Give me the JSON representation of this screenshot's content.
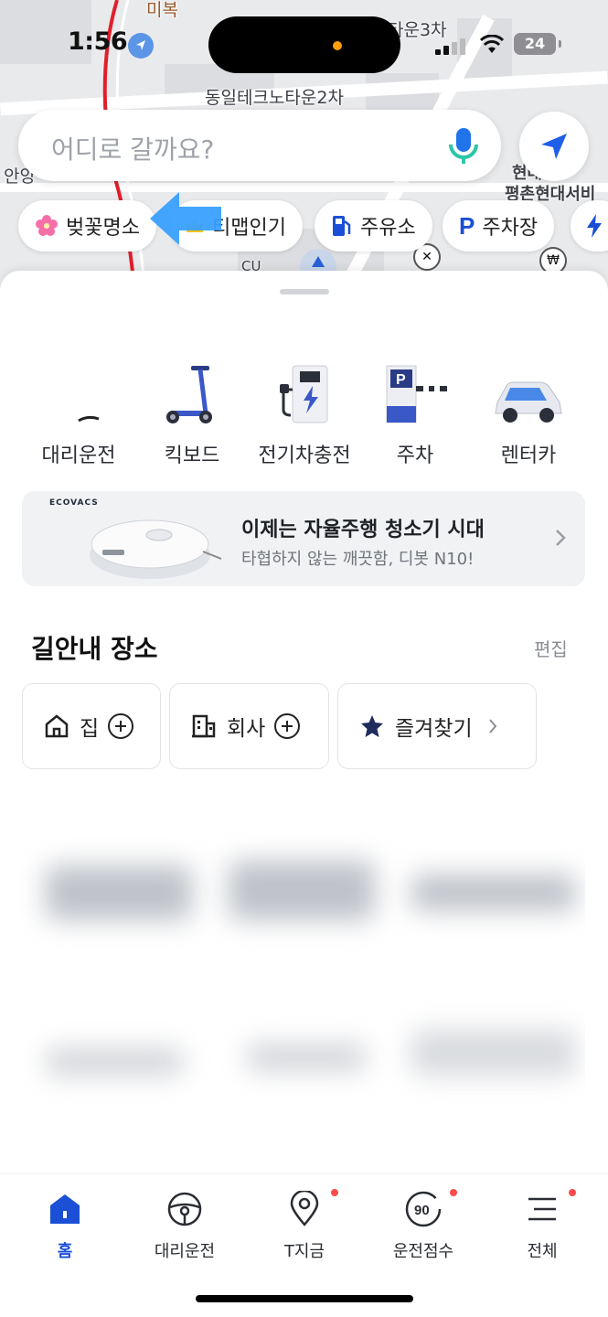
{
  "status": {
    "time": "1:56",
    "battery": "24"
  },
  "map": {
    "labels": [
      "미복",
      "타운3차",
      "동일테크노타운2차",
      "안양",
      "현대",
      "평촌현대서비",
      "CU"
    ]
  },
  "search": {
    "placeholder": "어디로 갈까요?"
  },
  "chips": [
    {
      "label": "벚꽃명소",
      "icon": "cherry-blossom-icon"
    },
    {
      "label": "티맵인기",
      "icon": "crown-icon"
    },
    {
      "label": "주유소",
      "icon": "gas-pump-icon"
    },
    {
      "label": "주차장",
      "icon": "parking-icon"
    }
  ],
  "services": [
    {
      "label": "대리운전",
      "icon": "chauffeur-icon"
    },
    {
      "label": "킥보드",
      "icon": "kickboard-icon"
    },
    {
      "label": "전기차충전",
      "icon": "ev-charger-icon"
    },
    {
      "label": "주차",
      "icon": "parking-gate-icon"
    },
    {
      "label": "렌터카",
      "icon": "rental-car-icon"
    }
  ],
  "ad": {
    "brand": "ECOVACS",
    "title": "이제는 자율주행 청소기 시대",
    "subtitle": "타협하지 않는 깨끗함, 디봇 N10!"
  },
  "places": {
    "title": "길안내 장소",
    "edit": "편집",
    "items": [
      {
        "label": "집",
        "icon": "home-icon"
      },
      {
        "label": "회사",
        "icon": "building-icon"
      },
      {
        "label": "즐겨찾기",
        "icon": "star-icon"
      }
    ]
  },
  "tabs": [
    {
      "label": "홈",
      "icon": "home-tab-icon"
    },
    {
      "label": "대리운전",
      "icon": "steering-wheel-icon"
    },
    {
      "label": "T지금",
      "icon": "location-pin-icon"
    },
    {
      "label": "운전점수",
      "icon": "score-90-icon"
    },
    {
      "label": "전체",
      "icon": "menu-icon"
    }
  ],
  "colors": {
    "accent": "#1a4fd6",
    "arrow": "#3aa0ff",
    "badge": "#ff4b4b"
  }
}
